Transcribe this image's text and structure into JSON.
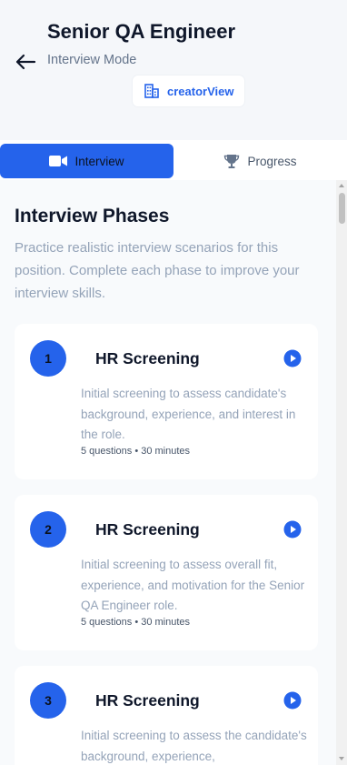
{
  "header": {
    "title": "Senior QA Engineer",
    "subtitle": "Interview Mode",
    "creator_label": "creatorView"
  },
  "tabs": [
    {
      "label": "Interview",
      "icon": "video-camera-icon",
      "active": true
    },
    {
      "label": "Progress",
      "icon": "trophy-icon",
      "active": false
    }
  ],
  "section": {
    "title": "Interview Phases",
    "description": "Practice realistic interview scenarios for this position. Complete each phase to improve your interview skills."
  },
  "phases": [
    {
      "number": "1",
      "title": "HR Screening",
      "description": "Initial screening to assess candidate's background, experience, and interest in the role.",
      "meta": "5 questions • 30 minutes"
    },
    {
      "number": "2",
      "title": "HR Screening",
      "description": "Initial screening to assess overall fit, experience, and motivation for the Senior QA Engineer role.",
      "meta": "5 questions • 30 minutes"
    },
    {
      "number": "3",
      "title": "HR Screening",
      "description": "Initial screening to assess the candidate's background, experience,",
      "meta": ""
    }
  ],
  "colors": {
    "accent": "#2563eb",
    "background": "#f5f7fa",
    "muted_text": "#94a3b8"
  }
}
